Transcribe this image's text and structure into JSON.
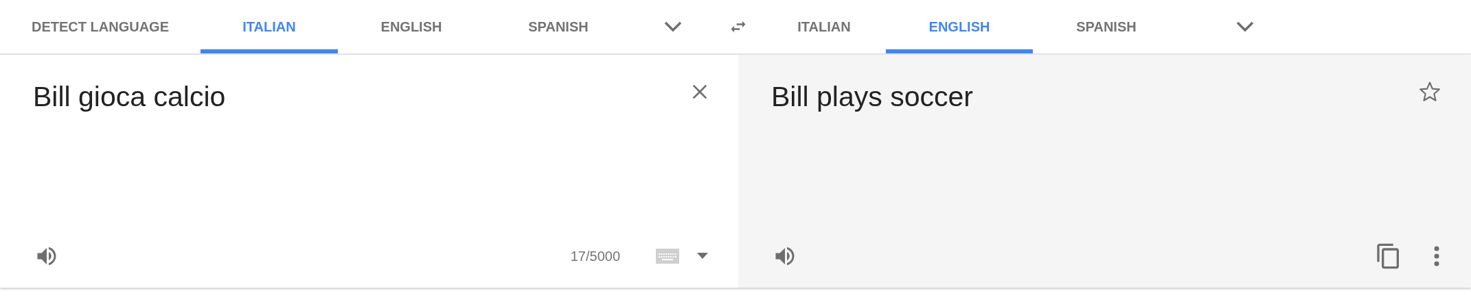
{
  "source_languages": [
    {
      "label": "DETECT LANGUAGE",
      "selected": false
    },
    {
      "label": "ITALIAN",
      "selected": true
    },
    {
      "label": "ENGLISH",
      "selected": false
    },
    {
      "label": "SPANISH",
      "selected": false
    }
  ],
  "target_languages": [
    {
      "label": "ITALIAN",
      "selected": false
    },
    {
      "label": "ENGLISH",
      "selected": true
    },
    {
      "label": "SPANISH",
      "selected": false
    }
  ],
  "source": {
    "text": "Bill gioca calcio",
    "counter": "17/5000"
  },
  "translation": {
    "text": "Bill plays soccer"
  }
}
